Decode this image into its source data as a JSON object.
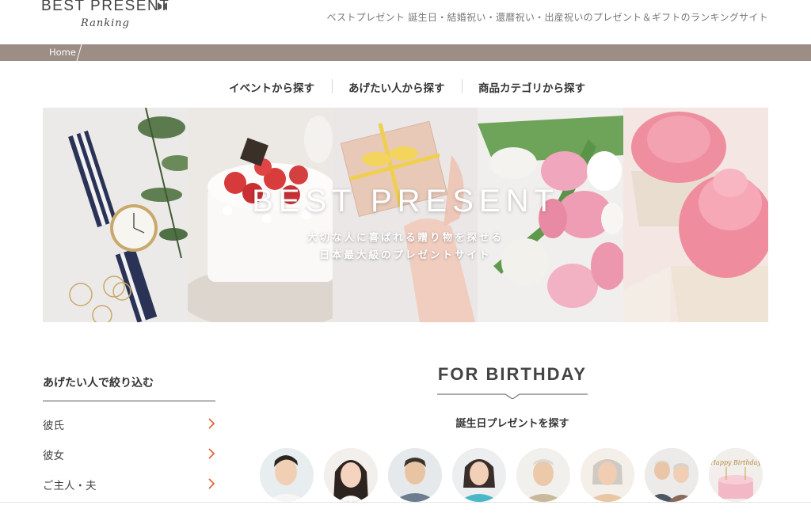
{
  "header": {
    "logo_main": "BEST PRESENT",
    "logo_sub": "Ranking",
    "tagline": "ベストプレゼント 誕生日・結婚祝い・還暦祝い・出産祝いのプレゼント＆ギフトのランキングサイト"
  },
  "breadcrumb": {
    "home": "Home"
  },
  "category_nav": {
    "items": [
      {
        "label": "イベントから探す"
      },
      {
        "label": "あげたい人から探す"
      },
      {
        "label": "商品カテゴリから探す"
      }
    ]
  },
  "hero": {
    "title": "BEST PRESENT",
    "subtitle_line1": "大切な人に喜ばれる贈り物を探せる",
    "subtitle_line2": "日本最大級のプレゼントサイト"
  },
  "sidebar": {
    "title": "あげたい人で絞り込む",
    "items": [
      {
        "label": "彼氏"
      },
      {
        "label": "彼女"
      },
      {
        "label": "ご主人・夫"
      }
    ]
  },
  "birthday": {
    "title": "FOR BIRTHDAY",
    "subtitle": "誕生日プレゼントを探す",
    "cake_topper_text": "Happy Birthday"
  },
  "colors": {
    "breadcrumb_bar": "#9c8d85",
    "accent_chevron": "#e0663a",
    "text": "#333333"
  }
}
